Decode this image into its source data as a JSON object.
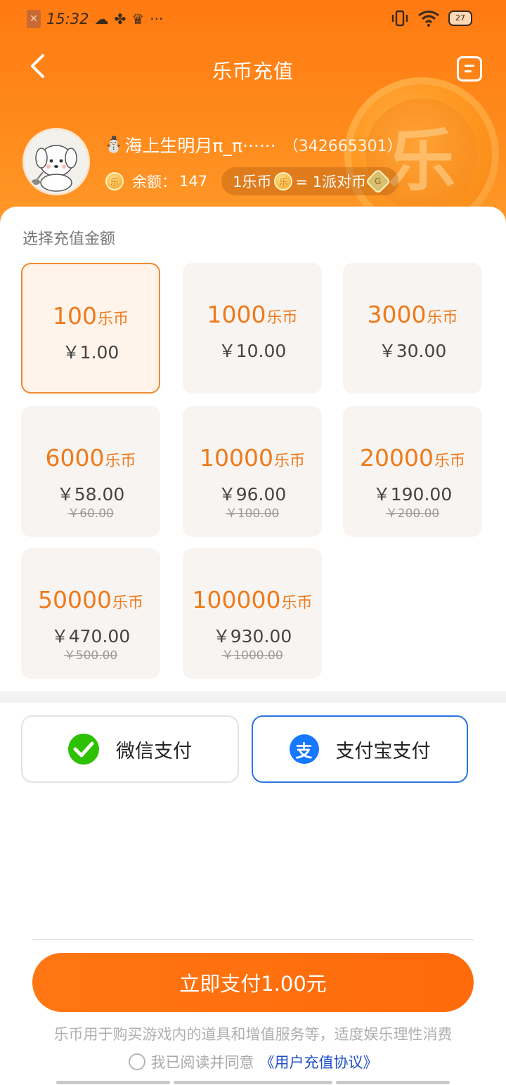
{
  "status_bar": {
    "time": "15:32",
    "battery": "27",
    "icons": [
      "sim-warning-icon",
      "cloud-icon",
      "fan-icon",
      "crown-icon",
      "more-dots-icon",
      "vibrate-icon",
      "wifi-icon",
      "battery-icon"
    ],
    "more": "···"
  },
  "header": {
    "title": "乐币充值",
    "big_coin_glyph": "乐",
    "colors": {
      "primary": "#ff7a12",
      "accent": "#ee7a1a",
      "selected_border": "#f08a30",
      "alipay_blue": "#1677ff",
      "wechat_green": "#2dc100"
    }
  },
  "user": {
    "name_prefix_icon": "⛄",
    "name": "海上生明月π_π······",
    "id": "（342665301）",
    "balance_label": "余额：",
    "balance_value": "147",
    "coin_glyph": "乐",
    "rate_left": "1乐币",
    "rate_right": "= 1派对币"
  },
  "recharge": {
    "section_title": "选择充值金额",
    "unit": "乐币",
    "packages": [
      {
        "amount": "100",
        "price": "￥1.00",
        "original": "",
        "selected": true
      },
      {
        "amount": "1000",
        "price": "￥10.00",
        "original": "",
        "selected": false
      },
      {
        "amount": "3000",
        "price": "￥30.00",
        "original": "",
        "selected": false
      },
      {
        "amount": "6000",
        "price": "￥58.00",
        "original": "￥60.00",
        "selected": false
      },
      {
        "amount": "10000",
        "price": "￥96.00",
        "original": "￥100.00",
        "selected": false
      },
      {
        "amount": "20000",
        "price": "￥190.00",
        "original": "￥200.00",
        "selected": false
      },
      {
        "amount": "50000",
        "price": "￥470.00",
        "original": "￥500.00",
        "selected": false
      },
      {
        "amount": "100000",
        "price": "￥930.00",
        "original": "￥1000.00",
        "selected": false
      }
    ]
  },
  "payment": {
    "wechat_label": "微信支付",
    "alipay_label": "支付宝支付",
    "selected": "alipay"
  },
  "footer": {
    "pay_button": "立即支付1.00元",
    "tip": "乐币用于购买游戏内的道具和增值服务等，适度娱乐理性消费",
    "agree_text": "我已阅读并同意",
    "agree_link": "《用户充值协议》"
  }
}
